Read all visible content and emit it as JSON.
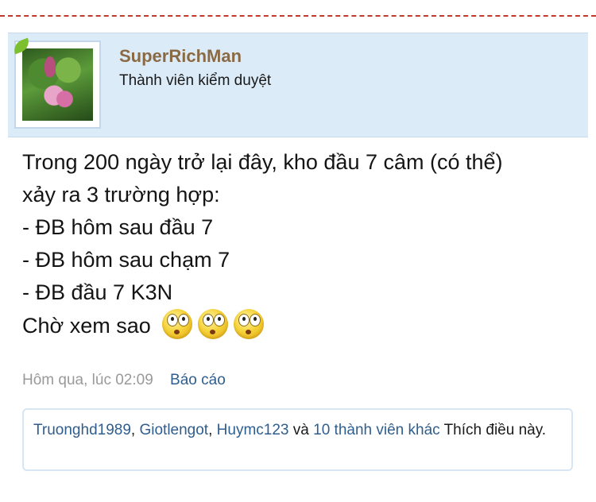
{
  "post": {
    "author": {
      "name": "SuperRichMan",
      "role": "Thành viên kiểm duyệt"
    },
    "body_lines": [
      "Trong 200 ngày trở lại đây, kho đầu 7 câm (có thể)",
      "xảy ra 3 trường hợp:",
      "- ĐB hôm sau đầu 7",
      "- ĐB hôm sau chạm 7",
      "- ĐB đầu 7 K3N",
      "Chờ xem sao"
    ],
    "emoji_count": 3,
    "emoji_icon": "eek-smiley-icon",
    "timestamp": "Hôm qua, lúc 02:09",
    "report_label": "Báo cáo",
    "likes": {
      "users": [
        "Truonghd1989",
        "Giotlengot",
        "Huymc123"
      ],
      "separator": ", ",
      "and_word": "và",
      "others_link": "10 thành viên khác",
      "suffix": "Thích điều này."
    },
    "colors": {
      "header_bg": "#dcebf8",
      "username": "#8a6a45",
      "link": "#2f5e8e",
      "divider": "#c0392b"
    }
  }
}
